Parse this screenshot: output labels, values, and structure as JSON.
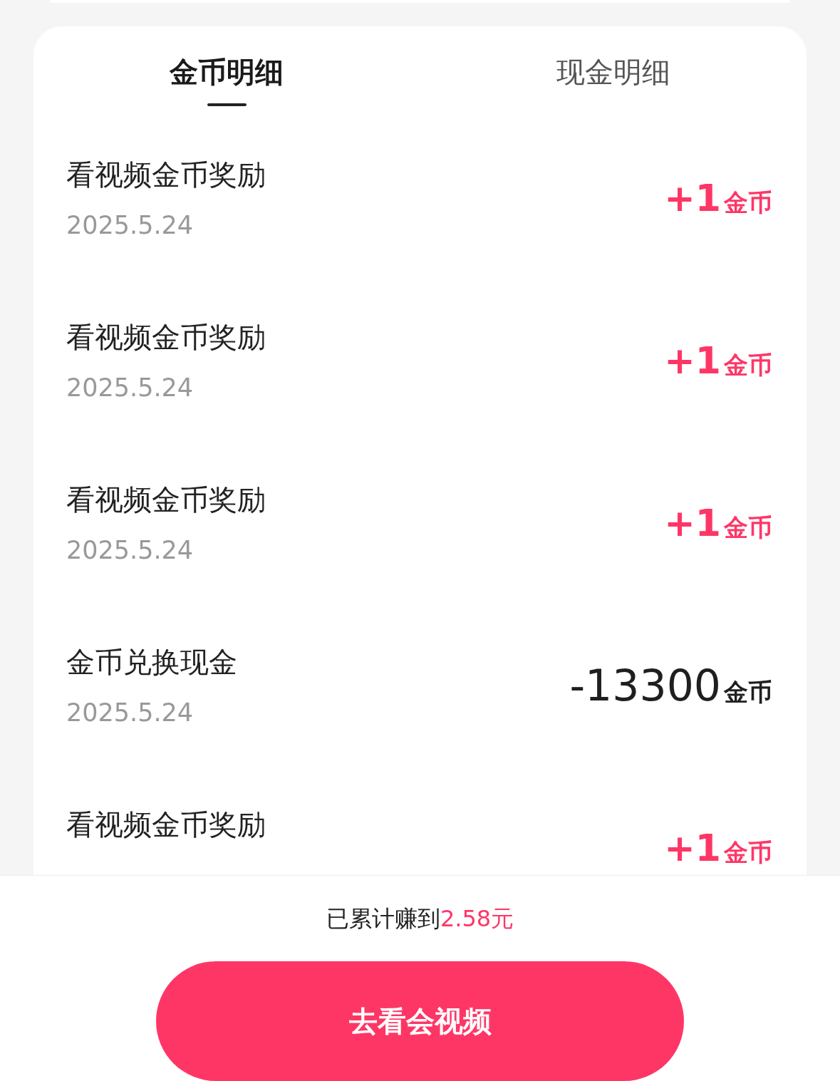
{
  "tabs": [
    {
      "label": "金币明细",
      "selected": true
    },
    {
      "label": "现金明细",
      "selected": false
    }
  ],
  "records": [
    {
      "title": "看视频金币奖励",
      "date": "2025.5.24",
      "kind": "income",
      "amount": "+1",
      "unit": "金币"
    },
    {
      "title": "看视频金币奖励",
      "date": "2025.5.24",
      "kind": "income",
      "amount": "+1",
      "unit": "金币"
    },
    {
      "title": "看视频金币奖励",
      "date": "2025.5.24",
      "kind": "income",
      "amount": "+1",
      "unit": "金币"
    },
    {
      "title": "金币兑换现金",
      "date": "2025.5.24",
      "kind": "expense",
      "amount": "-13300",
      "unit": "金币"
    },
    {
      "title": "看视频金币奖励",
      "kind": "income",
      "amount": "+1",
      "unit": "金币"
    }
  ],
  "summary": {
    "label": "已累计赚到",
    "value": "2.58元"
  },
  "action_button": "去看会视频"
}
